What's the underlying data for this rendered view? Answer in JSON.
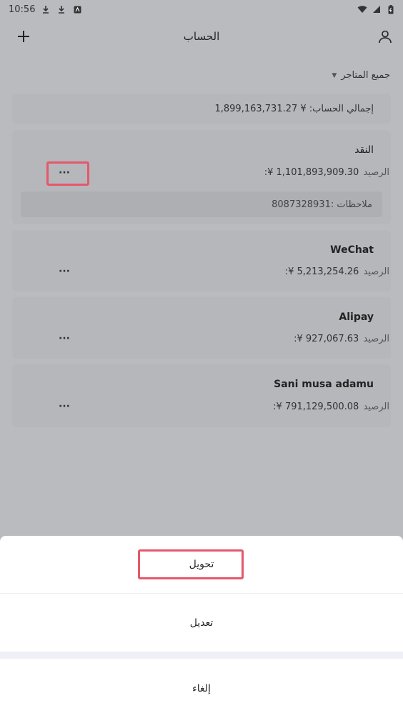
{
  "status_bar": {
    "time": "10:56",
    "left_icons": [
      "download-icon",
      "download-icon",
      "app-badge-icon"
    ],
    "right_icons": [
      "wifi-icon",
      "signal-icon",
      "battery-icon"
    ]
  },
  "app_bar": {
    "title": "الحساب",
    "left_icon": "plus-icon",
    "right_icon": "user-icon"
  },
  "filter": {
    "label": "جميع المتاجر"
  },
  "total": {
    "text": "إجمالي الحساب: ¥ 1,899,163,731.27"
  },
  "balance_label": "الرصيد",
  "accounts": [
    {
      "name": "النقد",
      "balance": ":¥ 1,101,893,909.30",
      "notes": "ملاحظات  :8087328931",
      "more": "···"
    },
    {
      "name": "WeChat",
      "balance": ":¥ 5,213,254.26",
      "more": "···"
    },
    {
      "name": "Alipay",
      "balance": ":¥ 927,067.63",
      "more": "···"
    },
    {
      "name": "Sani musa adamu",
      "balance": ":¥ 791,129,500.08",
      "more": "···"
    }
  ],
  "action_sheet": {
    "items": [
      {
        "label": "تحويل"
      },
      {
        "label": "تعديل"
      }
    ],
    "cancel": "إلغاء"
  },
  "colors": {
    "highlight": "#e5576a",
    "overlay": "#b9bbbf",
    "sheet": "#ffffff"
  }
}
